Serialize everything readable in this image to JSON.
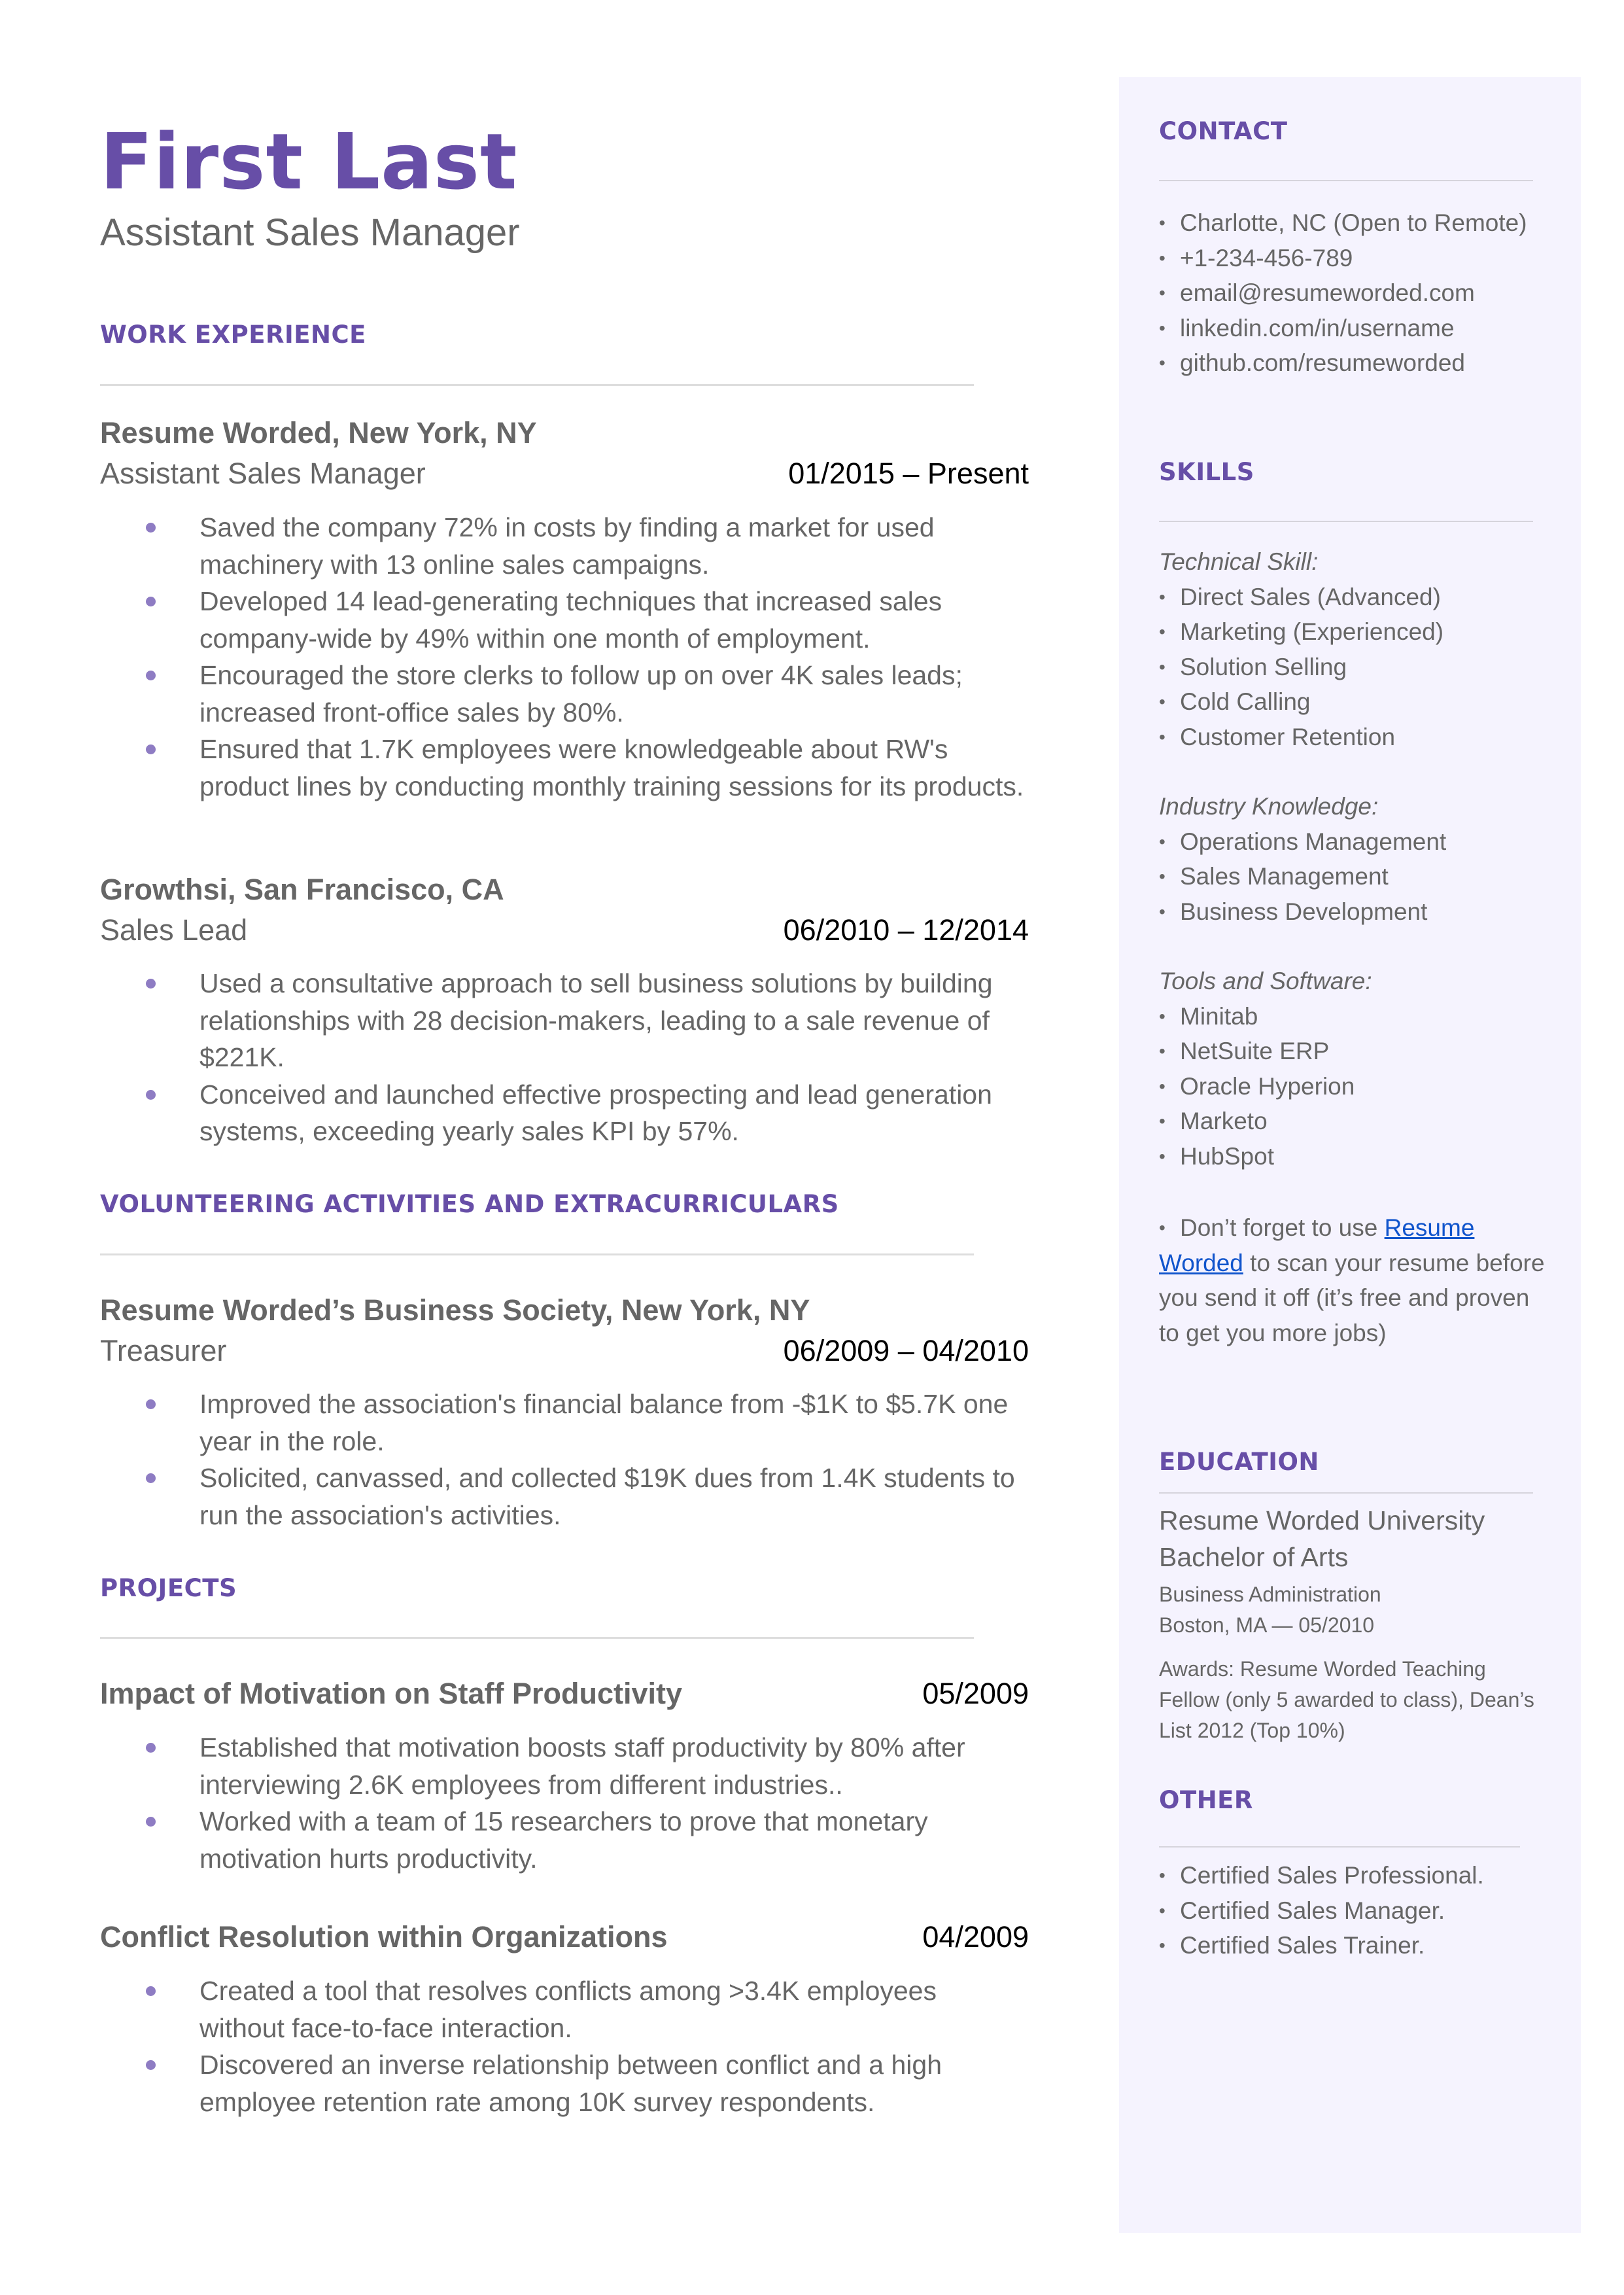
{
  "header": {
    "name": "First Last",
    "title": "Assistant Sales Manager"
  },
  "colors": {
    "accent": "#674ea7",
    "bullet": "#8e7cc3",
    "sidebar_bg": "#f5f3fe",
    "text": "#666666",
    "link": "#1155cc"
  },
  "work_experience": {
    "heading": "WORK EXPERIENCE",
    "jobs": [
      {
        "company": "Resume Worded, New York, NY",
        "role": "Assistant Sales Manager",
        "dates": "01/2015 – Present",
        "bullets": [
          "Saved the company 72% in costs by finding a market for used machinery with 13 online sales campaigns.",
          "Developed 14 lead-generating techniques that increased sales company-wide by 49% within one month of employment.",
          "Encouraged the store clerks to follow up on over 4K sales leads; increased front-office sales by 80%.",
          "Ensured that 1.7K employees were knowledgeable about RW's product lines by conducting monthly training sessions for its products."
        ]
      },
      {
        "company": "Growthsi, San Francisco, CA",
        "role": "Sales Lead",
        "dates": "06/2010 – 12/2014",
        "bullets": [
          "Used a consultative approach to sell business solutions by building relationships with 28 decision-makers, leading to a sale revenue of $221K.",
          "Conceived and launched effective prospecting and lead generation systems, exceeding yearly sales KPI by 57%."
        ]
      }
    ]
  },
  "volunteering": {
    "heading": "VOLUNTEERING ACTIVITIES AND EXTRACURRICULARS",
    "entries": [
      {
        "org": "Resume Worded’s Business Society, New York, NY",
        "role": "Treasurer",
        "dates": "06/2009 – 04/2010",
        "bullets": [
          "Improved the association's financial balance from -$1K to $5.7K one year in the role.",
          "Solicited, canvassed, and collected $19K dues from 1.4K students to run the association's activities."
        ]
      }
    ]
  },
  "projects": {
    "heading": "PROJECTS",
    "entries": [
      {
        "title": "Impact of Motivation on Staff Productivity",
        "date": "05/2009",
        "bullets": [
          "Established that motivation boosts staff productivity by 80% after interviewing 2.6K employees from different industries..",
          "Worked with a team of 15 researchers to prove that monetary motivation hurts productivity."
        ]
      },
      {
        "title": "Conflict Resolution within Organizations",
        "date": "04/2009",
        "bullets": [
          "Created a tool that resolves conflicts among >3.4K employees without face-to-face interaction.",
          "Discovered an inverse relationship between conflict and a high employee retention rate among 10K survey respondents."
        ]
      }
    ]
  },
  "sidebar": {
    "contact": {
      "heading": "CONTACT",
      "items": [
        "Charlotte, NC (Open to Remote)",
        "+1-234-456-789",
        "email@resumeworded.com",
        "linkedin.com/in/username",
        "github.com/resumeworded"
      ]
    },
    "skills": {
      "heading": "SKILLS",
      "groups": [
        {
          "label": "Technical Skill:",
          "items": [
            "Direct Sales (Advanced)",
            "Marketing (Experienced)",
            "Solution Selling",
            "Cold Calling",
            "Customer Retention"
          ]
        },
        {
          "label": "Industry Knowledge:",
          "items": [
            "Operations Management",
            "Sales Management",
            "Business Development"
          ]
        },
        {
          "label": "Tools and Software:",
          "items": [
            "Minitab",
            "NetSuite ERP",
            "Oracle Hyperion",
            "Marketo",
            "HubSpot"
          ]
        }
      ],
      "tip": {
        "before": "Don’t forget to use ",
        "link_text": "Resume Worded",
        "after": " to scan your resume before you send it off (it’s free and proven to get you more jobs)"
      }
    },
    "education": {
      "heading": "EDUCATION",
      "school": "Resume Worded University",
      "degree": "Bachelor of Arts",
      "major": "Business Administration",
      "location_date": "Boston, MA — 05/2010",
      "awards": "Awards: Resume Worded Teaching Fellow (only 5 awarded to class), Dean’s List 2012 (Top 10%)"
    },
    "other": {
      "heading": "OTHER",
      "items": [
        "Certified Sales Professional.",
        "Certified Sales Manager.",
        "Certified Sales Trainer."
      ]
    }
  }
}
